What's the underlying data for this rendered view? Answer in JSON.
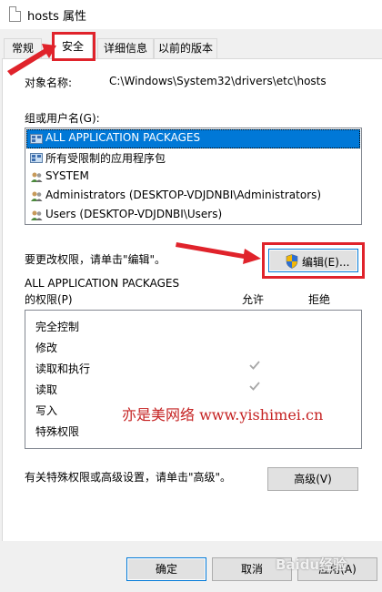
{
  "window": {
    "title": "hosts 属性"
  },
  "tabs": [
    {
      "label": "常规"
    },
    {
      "label": "安全"
    },
    {
      "label": "详细信息"
    },
    {
      "label": "以前的版本"
    }
  ],
  "security": {
    "object_name_label": "对象名称:",
    "object_name_value": "C:\\Windows\\System32\\drivers\\etc\\hosts",
    "groups_label": "组或用户名(G):",
    "groups": [
      {
        "name": "ALL APPLICATION PACKAGES",
        "icon": "app-package-icon",
        "selected": true
      },
      {
        "name": "所有受限制的应用程序包",
        "icon": "app-package-icon",
        "selected": false
      },
      {
        "name": "SYSTEM",
        "icon": "users-icon",
        "selected": false
      },
      {
        "name": "Administrators (DESKTOP-VDJDNBI\\Administrators)",
        "icon": "users-icon",
        "selected": false
      },
      {
        "name": "Users (DESKTOP-VDJDNBI\\Users)",
        "icon": "users-icon",
        "selected": false
      }
    ],
    "change_permissions_text": "要更改权限，请单击\"编辑\"。",
    "edit_button": "编辑(E)...",
    "permissions_for_line1": "ALL APPLICATION PACKAGES",
    "permissions_for_line2": "的权限(P)",
    "allow_header": "允许",
    "deny_header": "拒绝",
    "permissions": [
      {
        "name": "完全控制",
        "allow": false,
        "deny": false
      },
      {
        "name": "修改",
        "allow": false,
        "deny": false
      },
      {
        "name": "读取和执行",
        "allow": true,
        "deny": false
      },
      {
        "name": "读取",
        "allow": true,
        "deny": false
      },
      {
        "name": "写入",
        "allow": false,
        "deny": false
      },
      {
        "name": "特殊权限",
        "allow": false,
        "deny": false
      }
    ],
    "advanced_text": "有关特殊权限或高级设置，请单击\"高级\"。",
    "advanced_button": "高级(V)"
  },
  "footer": {
    "ok_button": "确定",
    "cancel_button": "取消",
    "apply_button": "应用(A)"
  },
  "overlays": {
    "watermark_text": "亦是美网络 www.yishimei.cn",
    "logo_text": "Baidu经验",
    "highlight_color": "#e0232b"
  }
}
